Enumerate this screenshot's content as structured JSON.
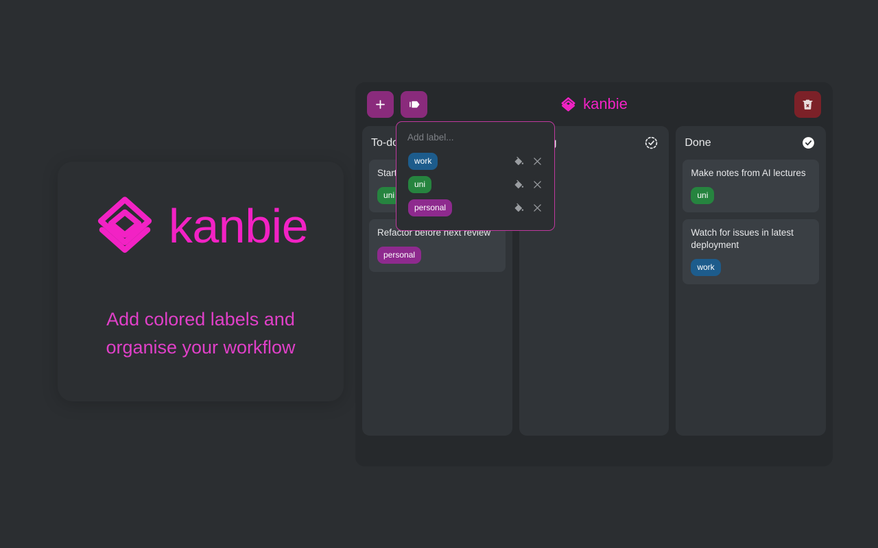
{
  "promo": {
    "logo_icon": "layers-icon",
    "wordmark": "kanbie",
    "tagline": "Add colored labels and organise your workflow",
    "accent_color": "#f222c4",
    "tagline_color": "#e040c8"
  },
  "board": {
    "header": {
      "add_button_label": "+",
      "add_button_icon": "plus-icon",
      "labels_button_icon": "tags-icon",
      "delete_button_icon": "trash-x-icon",
      "brand_icon": "layers-icon",
      "brand_name": "kanbie",
      "button_color": "#8a2b7c",
      "delete_button_color": "#7c2128"
    },
    "columns": [
      {
        "title": "To-do",
        "status_icon": "circle-dashed-icon",
        "cards": [
          {
            "text": "Start",
            "label": "uni"
          },
          {
            "text": "Refactor before next review",
            "label": "personal"
          }
        ]
      },
      {
        "title": "Doing",
        "status_icon": "circle-dashed-check-icon",
        "cards": []
      },
      {
        "title": "Done",
        "status_icon": "circle-check-filled-icon",
        "cards": [
          {
            "text": "Make notes from AI lectures",
            "label": "uni"
          },
          {
            "text": "Watch for issues in latest deployment",
            "label": "work"
          }
        ]
      }
    ]
  },
  "label_popover": {
    "input_placeholder": "Add label...",
    "input_value": "",
    "fill_icon": "paint-bucket-icon",
    "remove_icon": "close-x-icon",
    "labels": [
      {
        "name": "work",
        "color": "#1d5c8c"
      },
      {
        "name": "uni",
        "color": "#26843f"
      },
      {
        "name": "personal",
        "color": "#8e2a8e"
      }
    ]
  },
  "label_colors": {
    "work": "#1d5c8c",
    "uni": "#26843f",
    "personal": "#8e2a8e"
  }
}
